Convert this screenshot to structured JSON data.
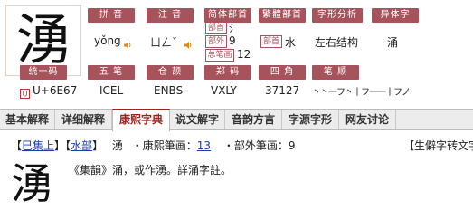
{
  "character": "湧",
  "labels": {
    "pinyin": "拼 音",
    "zhuyin": "注 音",
    "simp_radical": "简体部首",
    "trad_radical": "繁體部首",
    "structure": "字形分析",
    "variant": "异体字",
    "unicode": "统一码",
    "wubi": "五 笔",
    "cangjie": "仓 颉",
    "zhengma": "郑 码",
    "sijiao": "四 角",
    "strokes": "笔 顺"
  },
  "sub_labels": {
    "radical": "部首",
    "outside": "部外",
    "total": "总笔画",
    "trad": "部首"
  },
  "values": {
    "pinyin": "yǒng",
    "zhuyin": "ㄩㄥˇ",
    "simp_radical": "氵",
    "outside_strokes": "9",
    "total_strokes": "12",
    "trad_radical": "水",
    "structure": "左右结构",
    "variant": "涌",
    "unicode": "U+6E67",
    "wubi": "ICEL",
    "cangjie": "ENBS",
    "zhengma": "VXLY",
    "sijiao": "37127",
    "stroke_order": "丶丶一フ丶丨フ一一丨フノ"
  },
  "tabs": [
    "基本解释",
    "详细解释",
    "康熙字典",
    "说文解字",
    "音韵方言",
    "字源字形",
    "网友讨论"
  ],
  "active_tab": "康熙字典",
  "kangxi": {
    "open_b1": "【",
    "volume": "巳集上",
    "close_b1": "】",
    "open_b2": "【",
    "section": "水部",
    "close_b2": "】",
    "char": "湧",
    "kx_strokes_label": "・康熙筆画：",
    "kx_strokes": "13",
    "outside_label": "・部外筆画：",
    "outside": "9",
    "convert": "【生僻字转文字"
  },
  "definition": "《集韻》涌，或作湧。詳涌字註。",
  "colors": {
    "label_bg": "#a6535b",
    "link": "#1a3fa8",
    "active_tab": "#a02020"
  }
}
